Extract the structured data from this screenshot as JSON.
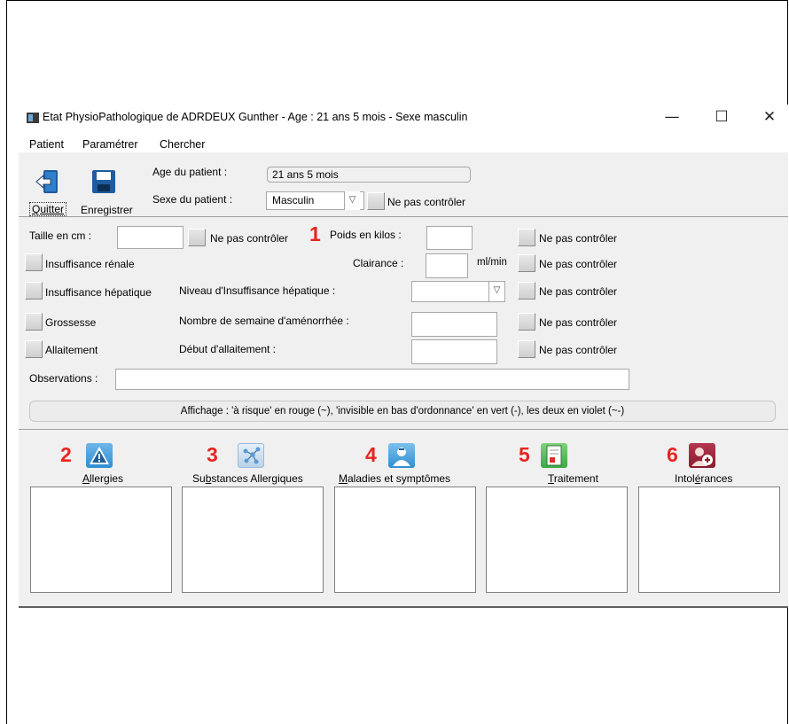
{
  "window": {
    "title": "Etat PhysioPathologique de ADRDEUX Gunther - Age : 21 ans 5 mois - Sexe masculin",
    "minimize_label": "—",
    "maximize_label": "☐",
    "close_label": "✕"
  },
  "menu": [
    "Patient",
    "Paramétrer",
    "Chercher"
  ],
  "toolbar": {
    "quit_label": "Quitter",
    "save_label": "Enregistrer"
  },
  "patient": {
    "age_label": "Age du patient :",
    "age_value": "21 ans 5 mois",
    "sex_label": "Sexe du patient :",
    "sex_value": "Masculin",
    "sex_no_check_label": "Ne pas contrôler"
  },
  "form": {
    "height_label": "Taille en cm :",
    "height_value": "",
    "height_no_check": "Ne pas contrôler",
    "weight_label": "Poids en kilos :",
    "weight_value": "",
    "weight_no_check": "Ne pas contrôler",
    "renal_label": "Insuffisance rénale",
    "clearance_label": "Clairance :",
    "clearance_value": "",
    "clearance_unit": "ml/min",
    "clearance_no_check": "Ne pas contrôler",
    "hepatic_label": "Insuffisance hépatique",
    "hepatic_level_label": "Niveau d'Insuffisance hépatique :",
    "hepatic_level_value": "",
    "hepatic_no_check": "Ne pas contrôler",
    "pregnancy_label": "Grossesse",
    "weeks_label": "Nombre de semaine d'aménorrhée :",
    "weeks_value": "",
    "pregnancy_no_check": "Ne pas contrôler",
    "breastfeeding_label": "Allaitement",
    "breastfeeding_start_label": "Début d'allaitement :",
    "breastfeeding_start_value": "",
    "breastfeeding_no_check": "Ne pas contrôler",
    "observations_label": "Observations :",
    "observations_value": ""
  },
  "banner": "Affichage : 'à risque' en rouge (~), 'invisible en bas d'ordonnance' en vert (-), les deux en violet (~-)",
  "annotations": [
    "1",
    "2",
    "3",
    "4",
    "5",
    "6"
  ],
  "categories": [
    {
      "pre": "",
      "ul": "A",
      "post": "llergies",
      "icon": "warning-icon"
    },
    {
      "pre": "Su",
      "ul": "b",
      "post": "stances Allergiques",
      "icon": "molecule-icon"
    },
    {
      "pre": "",
      "ul": "M",
      "post": "aladies et symptômes",
      "icon": "patient-icon"
    },
    {
      "pre": "",
      "ul": "T",
      "post": "raitement",
      "icon": "prescription-icon"
    },
    {
      "pre": "Intol",
      "ul": "é",
      "post": "rances",
      "icon": "intolerance-icon"
    }
  ],
  "colors": {
    "annotation": "#e8251f",
    "window_bg": "#f0f0f0",
    "icon_blue": "#2f8fd1",
    "icon_green": "#3aa845",
    "icon_maroon": "#8b1a2c"
  }
}
